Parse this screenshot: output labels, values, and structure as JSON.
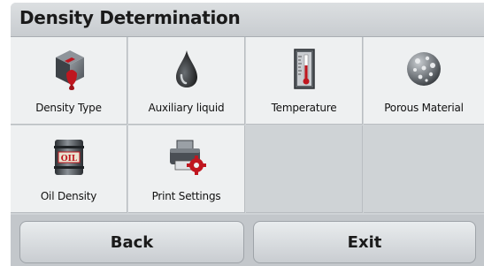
{
  "header": {
    "title": "Density Determination"
  },
  "tiles": [
    {
      "label": "Density Type",
      "icon": "density-type-icon"
    },
    {
      "label": "Auxiliary liquid",
      "icon": "liquid-drop-icon"
    },
    {
      "label": "Temperature",
      "icon": "thermometer-icon"
    },
    {
      "label": "Porous Material",
      "icon": "porous-rock-icon"
    },
    {
      "label": "Oil Density",
      "icon": "oil-barrel-icon",
      "icon_text": "OIL"
    },
    {
      "label": "Print Settings",
      "icon": "printer-settings-icon"
    }
  ],
  "footer": {
    "back_label": "Back",
    "exit_label": "Exit"
  },
  "colors": {
    "accent_red": "#c0161f",
    "title_bar": "#d3d6d9",
    "tile_bg": "#eef0f1"
  }
}
